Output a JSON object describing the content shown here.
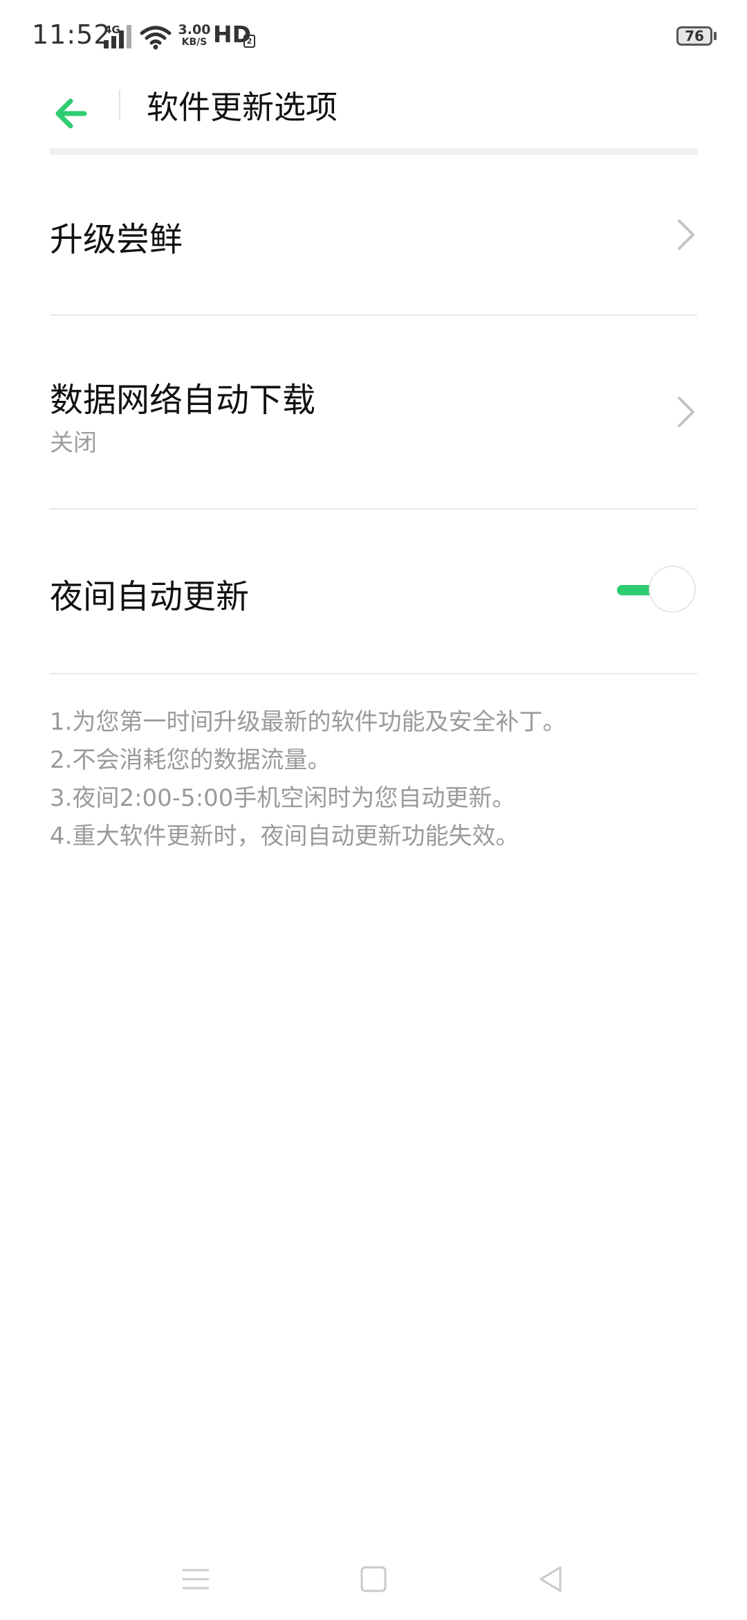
{
  "status_bar": {
    "time": "11:52",
    "network": "4G",
    "speed_value": "3.00",
    "speed_unit": "KB/S",
    "hd": "HD",
    "hd_sub": "2",
    "battery": "76"
  },
  "header": {
    "title": "软件更新选项",
    "accent_color": "#2ecc71"
  },
  "items": [
    {
      "title": "升级尝鲜",
      "control": "chevron"
    },
    {
      "title": "数据网络自动下载",
      "subtitle": "关闭",
      "control": "chevron"
    },
    {
      "title": "夜间自动更新",
      "control": "toggle",
      "toggle_on": true
    }
  ],
  "notes": [
    "1.为您第一时间升级最新的软件功能及安全补丁。",
    "2.不会消耗您的数据流量。",
    "3.夜间2:00-5:00手机空闲时为您自动更新。",
    "4.重大软件更新时，夜间自动更新功能失效。"
  ],
  "nav_bar": {
    "icons": [
      "menu-icon",
      "home-square-icon",
      "back-triangle-icon"
    ]
  }
}
